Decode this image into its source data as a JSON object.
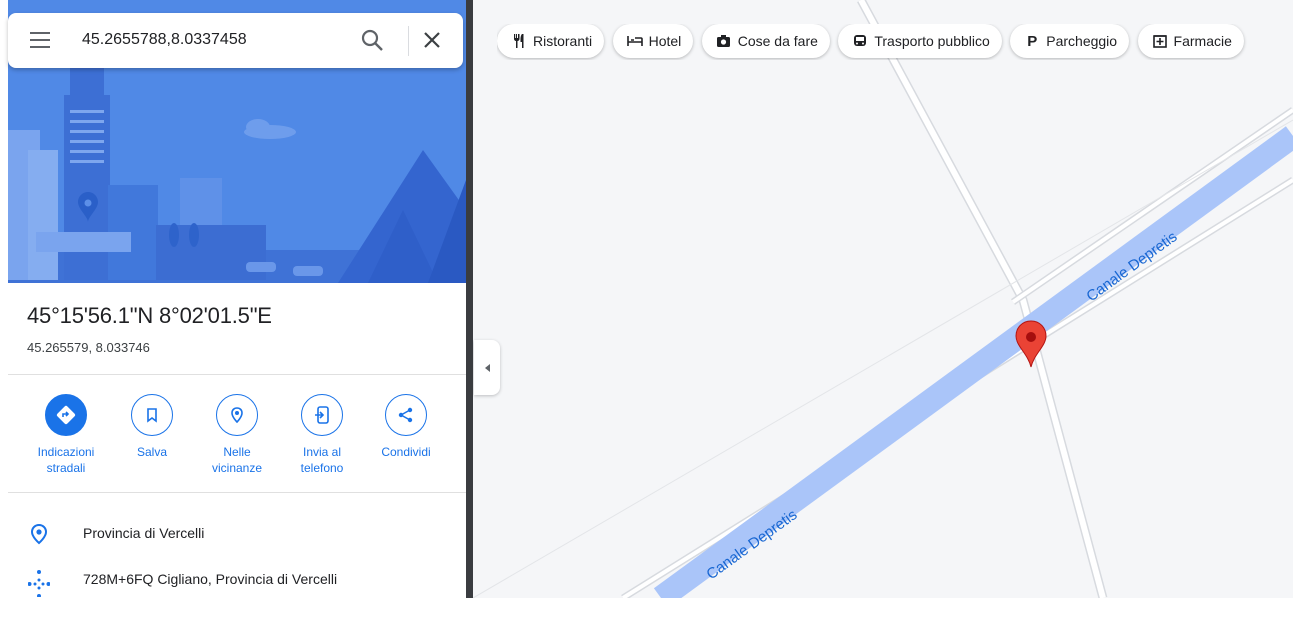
{
  "search": {
    "value": "45.2655788,8.0337458"
  },
  "place": {
    "title": "45°15'56.1\"N 8°02'01.5\"E",
    "decimal": "45.265579, 8.033746"
  },
  "actions": [
    {
      "label_line1": "Indicazioni",
      "label_line2": "stradali",
      "icon": "directions-icon"
    },
    {
      "label_line1": "Salva",
      "label_line2": "",
      "icon": "bookmark-icon"
    },
    {
      "label_line1": "Nelle",
      "label_line2": "vicinanze",
      "icon": "nearby-icon"
    },
    {
      "label_line1": "Invia al",
      "label_line2": "telefono",
      "icon": "send-to-phone-icon"
    },
    {
      "label_line1": "Condividi",
      "label_line2": "",
      "icon": "share-icon"
    }
  ],
  "details": [
    {
      "text": "Provincia di Vercelli",
      "icon": "location-pin-icon"
    },
    {
      "text": "728M+6FQ Cigliano, Provincia di Vercelli",
      "icon": "plus-code-icon"
    }
  ],
  "chips": [
    {
      "label": "Ristoranti",
      "icon": "restaurant-icon"
    },
    {
      "label": "Hotel",
      "icon": "hotel-icon"
    },
    {
      "label": "Cose da fare",
      "icon": "camera-icon"
    },
    {
      "label": "Trasporto pubblico",
      "icon": "transit-icon"
    },
    {
      "label": "Parcheggio",
      "icon": "parking-icon"
    },
    {
      "label": "Farmacie",
      "icon": "pharmacy-icon"
    }
  ],
  "map": {
    "canal_label_upper": "Canale Depretis",
    "canal_label_lower": "Canale Depretis"
  },
  "colors": {
    "accent": "#1a73e8",
    "hero_blue": "#4f85e3",
    "water": "#aac5f9",
    "pin_red": "#ea4335"
  }
}
